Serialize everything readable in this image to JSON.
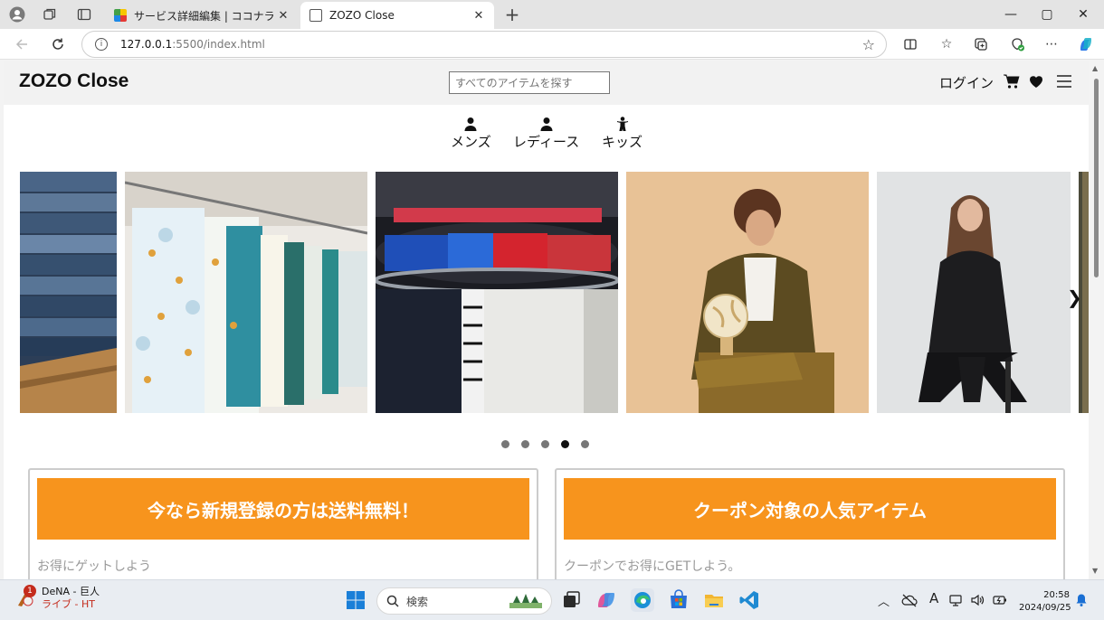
{
  "browser": {
    "tabs": [
      {
        "title": "サービス詳細編集 | ココナラ",
        "active": false
      },
      {
        "title": "ZOZO Close",
        "active": true
      }
    ],
    "new_tab_label": "+",
    "address": {
      "host": "127.0.0.1",
      "path": ":5500/index.html"
    },
    "window_controls": {
      "minimize": "—",
      "maximize": "▢",
      "close": "✕"
    }
  },
  "site": {
    "logo": "ZOZO Close",
    "search": {
      "placeholder": "すべてのアイテムを探す"
    },
    "login": "ログイン",
    "categories": [
      {
        "label": "メンズ",
        "icon": "user-icon"
      },
      {
        "label": "レディース",
        "icon": "user-icon"
      },
      {
        "label": "キッズ",
        "icon": "child-icon"
      }
    ],
    "carousel": {
      "next_label": "❯",
      "slides": [
        "jeans-stack",
        "baby-clothes-rack",
        "round-clothing-rack",
        "man-with-globe",
        "woman-in-black-suit",
        "partial-slide"
      ],
      "dot_count": 5,
      "active_dot": 4
    },
    "promos": [
      {
        "title": "今なら新規登録の方は送料無料！",
        "subtitle": "お得にゲットしよう"
      },
      {
        "title": "クーポン対象の人気アイテム",
        "subtitle": "クーポンでお得にGETしよう。"
      }
    ],
    "colors": {
      "accent": "#f7941d",
      "header_bg": "#f2f2f2"
    }
  },
  "taskbar": {
    "news": {
      "badge": "1",
      "line1": "DeNA - 巨人",
      "line2": "ライブ - HT"
    },
    "search_placeholder": "検索",
    "clock": {
      "time": "20:58",
      "date": "2024/09/25"
    },
    "ime": "A"
  }
}
